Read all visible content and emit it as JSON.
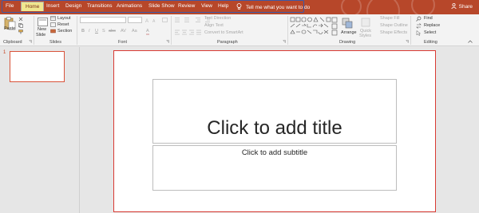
{
  "menu": {
    "tabs": [
      {
        "label": "File"
      },
      {
        "label": "Home"
      },
      {
        "label": "Insert"
      },
      {
        "label": "Design"
      },
      {
        "label": "Transitions"
      },
      {
        "label": "Animations"
      },
      {
        "label": "Slide Show"
      },
      {
        "label": "Review"
      },
      {
        "label": "View"
      },
      {
        "label": "Help"
      }
    ],
    "active_tab": "Home",
    "tell_me": "Tell me what you want to do",
    "share": "Share"
  },
  "ribbon": {
    "groups": {
      "clipboard": "Clipboard",
      "slides": "Slides",
      "font": "Font",
      "paragraph": "Paragraph",
      "drawing": "Drawing",
      "editing": "Editing"
    },
    "clipboard": {
      "paste": "Paste"
    },
    "slides": {
      "new_slide_line1": "New",
      "new_slide_line2": "Slide",
      "layout": "Layout",
      "reset": "Reset",
      "section": "Section"
    },
    "font": {
      "bold": "B",
      "italic": "I",
      "underline": "U",
      "strike": "S",
      "abc": "abc",
      "av": "AV",
      "aa": "Aa",
      "font_color": "A"
    },
    "paragraph": {
      "text_direction": "Text Direction",
      "align_text": "Align Text",
      "convert_smartart": "Convert to SmartArt"
    },
    "drawing": {
      "arrange": "Arrange",
      "quick_styles_1": "Quick",
      "quick_styles_2": "Styles",
      "shape_fill": "Shape Fill",
      "shape_outline": "Shape Outline",
      "shape_effects": "Shape Effects"
    },
    "editing": {
      "find": "Find",
      "replace": "Replace",
      "select": "Select"
    }
  },
  "thumbnails": {
    "slide_number": "1"
  },
  "slide": {
    "title_placeholder": "Click to add title",
    "subtitle_placeholder": "Click to add subtitle"
  },
  "colors": {
    "accent": "#b7472a",
    "active_tab_bg": "#f0e78f",
    "highlight_border": "#3d5aa8",
    "selection": "#d93a33"
  }
}
